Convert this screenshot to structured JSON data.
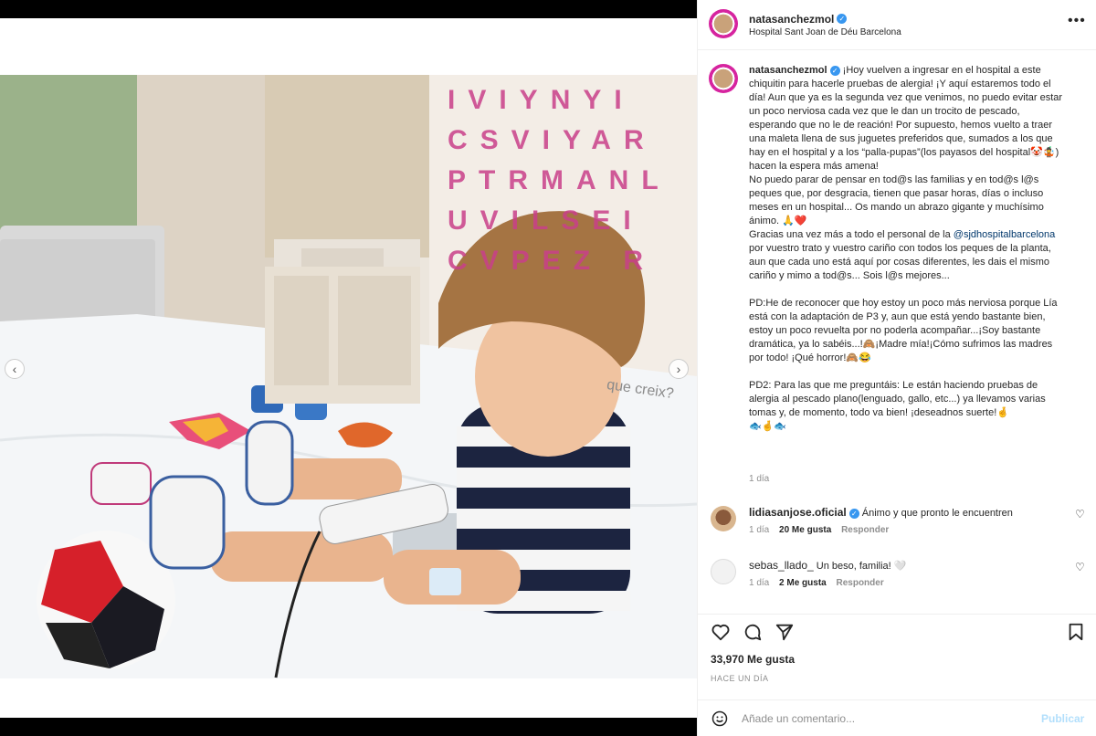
{
  "post": {
    "username": "natasanchezmol",
    "location": "Hospital Sant Joan de Déu Barcelona",
    "more_icon": "more-horizontal-icon"
  },
  "caption": {
    "username": "natasanchezmol",
    "text_part1": "¡Hoy vuelven a ingresar en el hospital a este chiquitin para hacerle pruebas de alergia! ¡Y aquí estaremos todo el día! Aun que ya es la segunda vez que venimos, no puedo evitar estar un poco nerviosa cada vez que le dan un trocito de pescado, esperando que no le de reación! Por supuesto, hemos vuelto a traer una maleta llena de sus juguetes preferidos que, sumados a los que hay en el hospital y a los “palla-pupas”(los payasos del hospital🤡🤹) hacen la espera más amena!\nNo puedo parar de pensar en tod@s las familias y en tod@s l@s peques que, por desgracia, tienen que pasar horas, días o incluso meses en un hospital... Os mando un abrazo gigante y muchísimo ánimo. 🙏❤️\nGracias una vez más a todo el personal de la ",
    "mention": "@sjdhospitalbarcelona",
    "text_part2": " por vuestro trato y vuestro cariño con todos los peques de la planta, aun que cada uno está aquí por cosas diferentes, les dais el mismo cariño y mimo a tod@s... Sois l@s mejores...\n\nPD:He de reconocer que hoy estoy un poco más nerviosa porque Lía está con la adaptación de P3 y, aun que está yendo bastante bien, estoy un poco revuelta por no poderla acompañar...¡Soy bastante dramática, ya lo sabéis...!🙈¡Madre mía!¡Cómo sufrimos las madres por todo! ¡Qué horror!🙈😂\n\nPD2: Para las que me preguntáis: Le están haciendo pruebas de alergia al pescado plano(lenguado, gallo, etc...) ya llevamos varias tomas y, de momento, todo va bien! ¡deseadnos suerte!🤞\n🐟🤞🐟",
    "time": "1 día"
  },
  "comments": [
    {
      "username": "lidiasanjose.oficial",
      "text": "Ánimo y que pronto le encuentren",
      "time": "1 día",
      "likes": "20 Me gusta",
      "reply": "Responder"
    },
    {
      "username": "sebas_llado_",
      "text": "Un beso, familia! 🤍",
      "time": "1 día",
      "likes": "2 Me gusta",
      "reply": "Responder"
    }
  ],
  "actions": {
    "like_icon": "heart-icon",
    "comment_icon": "comment-icon",
    "share_icon": "share-icon",
    "save_icon": "bookmark-icon"
  },
  "likes_text": "33,970 Me gusta",
  "post_time": "HACE UN DÍA",
  "comment_box": {
    "placeholder": "Añade un comentario...",
    "publish_label": "Publicar",
    "emoji_icon": "emoji-icon"
  },
  "photo": {
    "banner_letters": "IVIYNYI\nCSVIYAR\nPTRMANL\nUVILSEI\nCVPEZ R",
    "banner_tagline": "que creix?"
  },
  "navigation": {
    "prev_symbol": "‹",
    "next_symbol": "›"
  }
}
